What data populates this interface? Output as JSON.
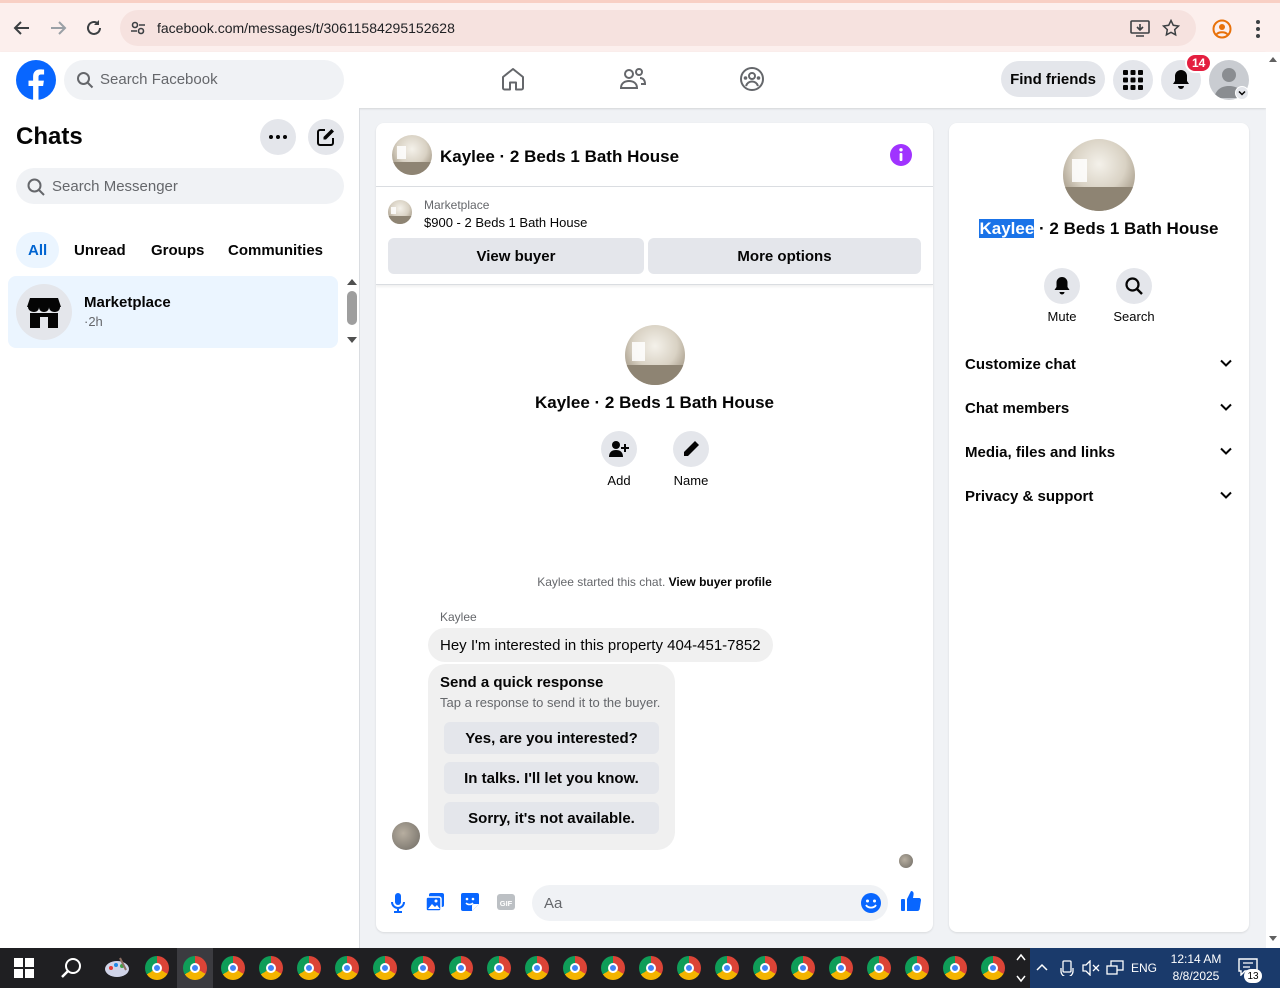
{
  "browser": {
    "url": "facebook.com/messages/t/30611584295152628"
  },
  "header": {
    "search_placeholder": "Search Facebook",
    "find_friends_label": "Find friends",
    "notification_count": "14"
  },
  "chats": {
    "title": "Chats",
    "search_placeholder": "Search Messenger",
    "filters": [
      {
        "label": "All",
        "active": true
      },
      {
        "label": "Unread",
        "active": false
      },
      {
        "label": "Groups",
        "active": false
      },
      {
        "label": "Communities",
        "active": false
      }
    ],
    "items": [
      {
        "name": "Marketplace",
        "time": "·2h"
      }
    ]
  },
  "conversation": {
    "title": "Kaylee · 2 Beds 1 Bath House",
    "marketplace_label": "Marketplace",
    "listing": "$900 - 2 Beds 1 Bath House",
    "view_buyer_label": "View buyer",
    "more_options_label": "More options",
    "profile_name": "Kaylee · 2 Beds 1 Bath House",
    "add_label": "Add",
    "name_label": "Name",
    "started_text": "Kaylee started this chat.",
    "view_profile_label": "View buyer profile",
    "sender": "Kaylee",
    "message": "Hey I'm interested in this property 404-451-7852",
    "quick_response": {
      "title": "Send a quick response",
      "subtitle": "Tap a response to send it to the buyer.",
      "options": [
        "Yes, are you interested?",
        "In talks. I'll let you know.",
        "Sorry, it's not available."
      ]
    },
    "composer_placeholder": "Aa"
  },
  "details": {
    "name_highlight": "Kaylee",
    "name_rest": " · 2 Beds 1 Bath House",
    "mute_label": "Mute",
    "search_label": "Search",
    "sections": [
      "Customize chat",
      "Chat members",
      "Media, files and links",
      "Privacy & support"
    ]
  },
  "taskbar": {
    "language": "ENG",
    "time": "12:14 AM",
    "date": "8/8/2025",
    "notification_count": "13"
  },
  "colors": {
    "fb_blue": "#0866ff",
    "accent_purple": "#a033ff",
    "badge_red": "#e41e3f"
  }
}
